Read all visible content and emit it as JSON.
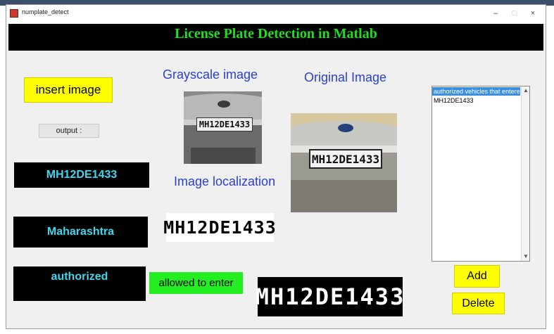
{
  "window": {
    "title": "numplate_detect",
    "minimize": "–",
    "maximize": "□",
    "close": "×"
  },
  "header": {
    "title": "License Plate Detection in Matlab"
  },
  "buttons": {
    "insert_image": "insert image",
    "output": "output :",
    "add": "Add",
    "delete": "Delete"
  },
  "outputs": {
    "plate_number": "MH12DE1433",
    "state": "Maharashtra",
    "status": "authorized",
    "access": "allowed to enter"
  },
  "labels": {
    "grayscale": "Grayscale image",
    "original": "Original Image",
    "localization": "Image localization"
  },
  "plates": {
    "grayscale_plate": "MH12DE1433",
    "original_plate": "MH12DE1433",
    "localized_plate": "MH12DE1433",
    "binary_plate": "MH12DE1433"
  },
  "listbox": {
    "items": [
      "authorized vehicles that entered",
      "MH12DE1433"
    ],
    "selected_index": 0
  },
  "colors": {
    "header_bg": "#000000",
    "header_text": "#22dd22",
    "button_yellow": "#ffff00",
    "output_text": "#3fd8ee",
    "label_blue": "#2a3fd0",
    "allowed_green": "#22ee22",
    "list_selection": "#3b8fe0"
  },
  "icons": {
    "app_icon": "matlab-figure-icon",
    "scroll_up": "chevron-up-icon",
    "scroll_down": "chevron-down-icon"
  }
}
